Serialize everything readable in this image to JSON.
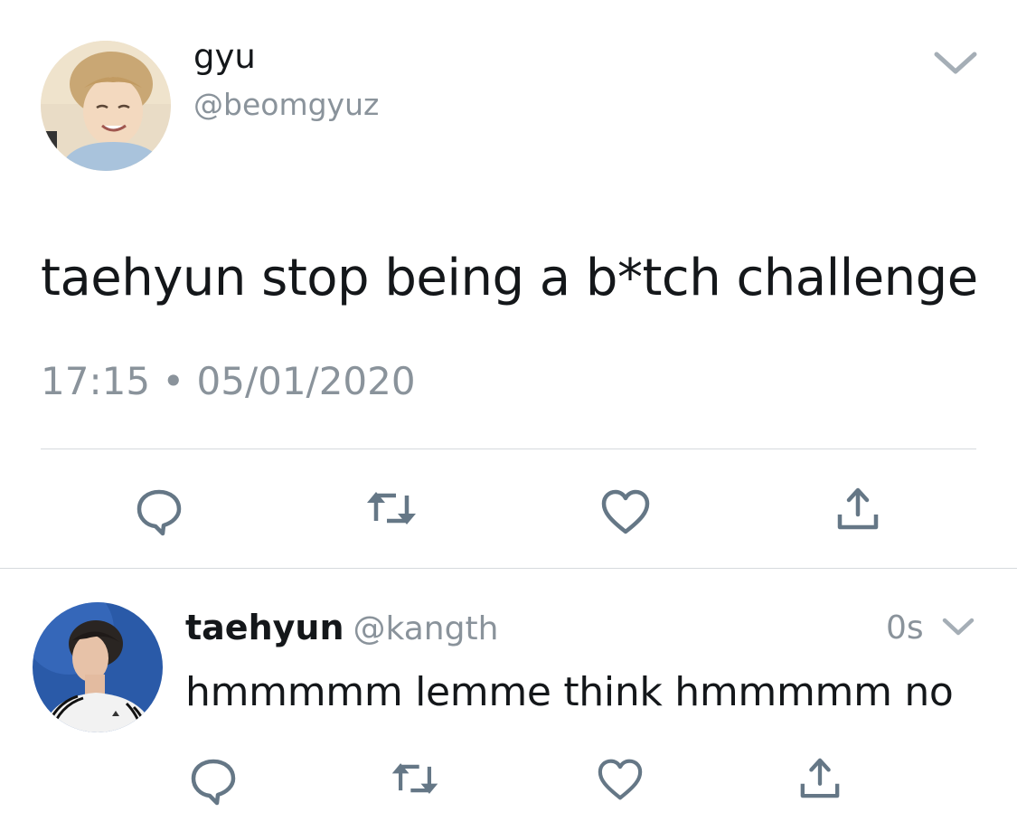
{
  "main_tweet": {
    "display_name": "gyu",
    "handle": "@beomgyuz",
    "text": "taehyun stop being a b*tch challenge",
    "timestamp": "17:15 • 05/01/2020"
  },
  "reply_tweet": {
    "display_name": "taehyun",
    "handle": "@kangth",
    "time": "0s",
    "text": "hmmmmm lemme think hmmmmm no"
  },
  "actions": {
    "reply_icon": "reply-bubble-icon",
    "retweet_icon": "retweet-arrows-icon",
    "like_icon": "heart-icon",
    "share_icon": "share-upload-icon"
  },
  "colors": {
    "icon_gray": "#657786",
    "secondary_text": "#8a939b",
    "divider": "#d6dadd"
  }
}
